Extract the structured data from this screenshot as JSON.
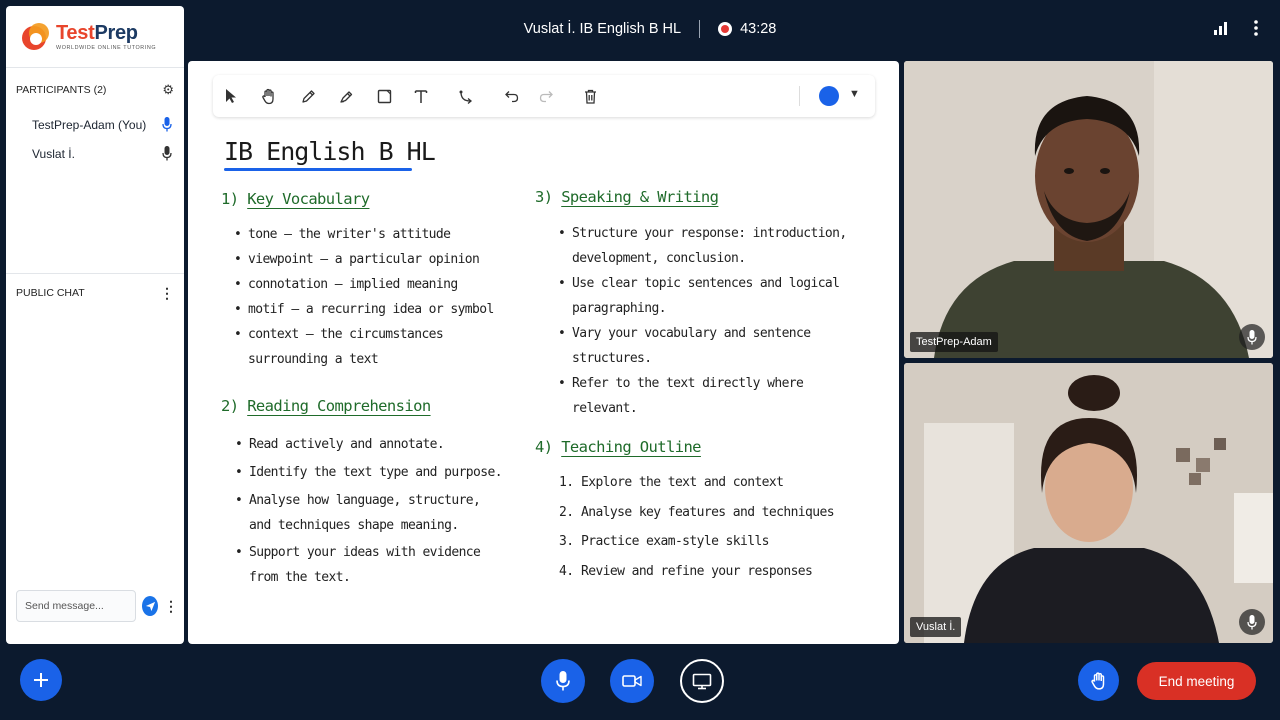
{
  "app": {
    "brand_name_part1": "Test",
    "brand_name_part2": "Prep",
    "brand_tagline": "WORLDWIDE ONLINE TUTORING"
  },
  "topbar": {
    "meeting_title": "Vuslat İ. IB English B HL",
    "timer": "43:28"
  },
  "participants": {
    "header": "PARTICIPANTS (2)",
    "list": [
      {
        "name": "TestPrep-Adam (You)",
        "mic_color": "#1a62e8"
      },
      {
        "name": "Vuslat İ.",
        "mic_color": "#333333"
      }
    ]
  },
  "chat": {
    "header": "PUBLIC CHAT",
    "input_placeholder": "Send message..."
  },
  "whiteboard": {
    "current_color": "#1a62e8",
    "title": "IB English B HL",
    "sections": [
      {
        "number": "1)",
        "title": "Key Vocabulary",
        "bullets": [
          [
            "tone – the writer's attitude"
          ],
          [
            "viewpoint – a particular opinion"
          ],
          [
            "connotation – implied meaning"
          ],
          [
            "motif – a recurring idea or symbol"
          ],
          [
            "context – the circumstances",
            "surrounding a text"
          ]
        ]
      },
      {
        "number": "2)",
        "title": "Reading Comprehension",
        "bullets": [
          [
            "Read actively and annotate."
          ],
          [
            "Identify the text type and purpose."
          ],
          [
            "Analyse how language, structure,",
            "and techniques shape meaning."
          ],
          [
            "Support your ideas with evidence",
            "from the text."
          ]
        ]
      },
      {
        "number": "3)",
        "title": "Speaking & Writing",
        "bullets": [
          [
            "Structure your response: introduction,",
            "development, conclusion."
          ],
          [
            "Use clear topic sentences and logical",
            "paragraphing."
          ],
          [
            "Vary your vocabulary and sentence",
            "structures."
          ],
          [
            "Refer to the text directly where",
            "relevant."
          ]
        ]
      },
      {
        "number": "4)",
        "title": "Teaching Outline",
        "items": [
          {
            "n": "1.",
            "text": "Explore the text and context"
          },
          {
            "n": "2.",
            "text": "Analyse key features and techniques"
          },
          {
            "n": "3.",
            "text": "Practice exam-style skills"
          },
          {
            "n": "4.",
            "text": "Review and refine your responses"
          }
        ]
      }
    ]
  },
  "videos": [
    {
      "name": "TestPrep-Adam"
    },
    {
      "name": "Vuslat İ."
    }
  ],
  "bottombar": {
    "end_meeting_label": "End meeting"
  }
}
